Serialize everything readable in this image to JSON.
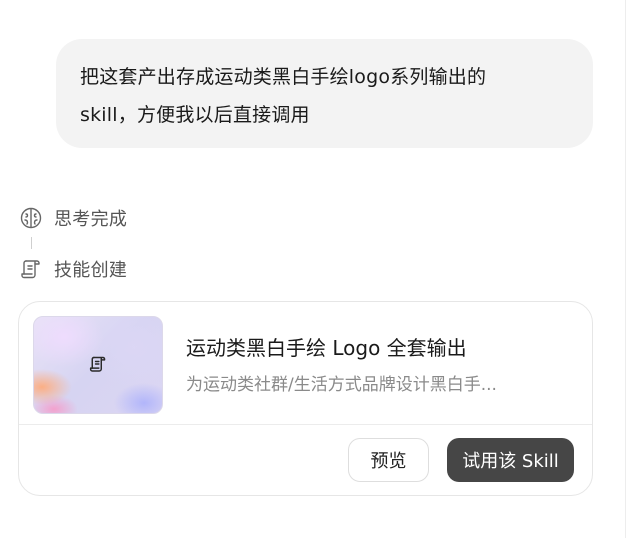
{
  "user_message": {
    "line1": "把这套产出存成运动类黑白手绘logo系列输出的",
    "line2": "skill，方便我以后直接调用"
  },
  "steps": [
    {
      "icon": "brain-icon",
      "label": "思考完成"
    },
    {
      "icon": "scroll-icon",
      "label": "技能创建"
    }
  ],
  "skill_card": {
    "thumbnail_icon": "scroll-icon",
    "title": "运动类黑白手绘 Logo 全套输出",
    "description": "为运动类社群/生活方式品牌设计黑白手...",
    "preview_label": "预览",
    "try_label": "试用该 Skill"
  },
  "colors": {
    "bubble_bg": "#f3f3f3",
    "primary_button": "#464646",
    "muted_text": "#8a8a8a"
  }
}
